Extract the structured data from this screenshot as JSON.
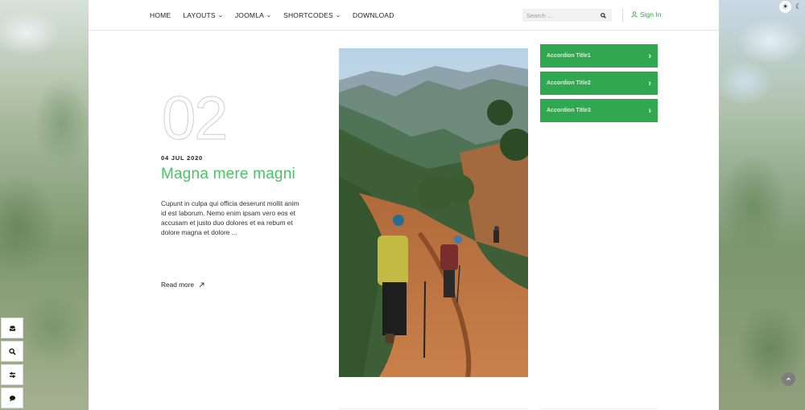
{
  "header": {
    "nav": [
      {
        "label": "HOME"
      },
      {
        "label": "LAYOUTS",
        "has_dropdown": true
      },
      {
        "label": "JOOMLA",
        "has_dropdown": true
      },
      {
        "label": "SHORTCODES",
        "has_dropdown": true
      },
      {
        "label": "DOWNLOAD"
      }
    ],
    "search_placeholder": "Search ...",
    "signin_label": "Sign In"
  },
  "article": {
    "number": "02",
    "date": "04 JUL 2020",
    "title": "Magna mere magni",
    "excerpt": "Cupunt in culpa qui officia deserunt mollit anim id est laborum. Nemo enim ipsam vero eos et accusam et justo duo dolores et ea rebum et dolore magna et dolore ...",
    "read_more": "Read more",
    "image_icon": "hikers-mountain-photo"
  },
  "accordion": [
    {
      "label": "Accordion Title1"
    },
    {
      "label": "Accordion Title2"
    },
    {
      "label": "Accordion Title3"
    }
  ],
  "side_toolbar": [
    {
      "icon": "inbox-icon"
    },
    {
      "icon": "search-icon"
    },
    {
      "icon": "sliders-icon"
    },
    {
      "icon": "chat-icon"
    }
  ],
  "colors": {
    "accent": "#2fa84f",
    "title_green": "#4cc266"
  }
}
